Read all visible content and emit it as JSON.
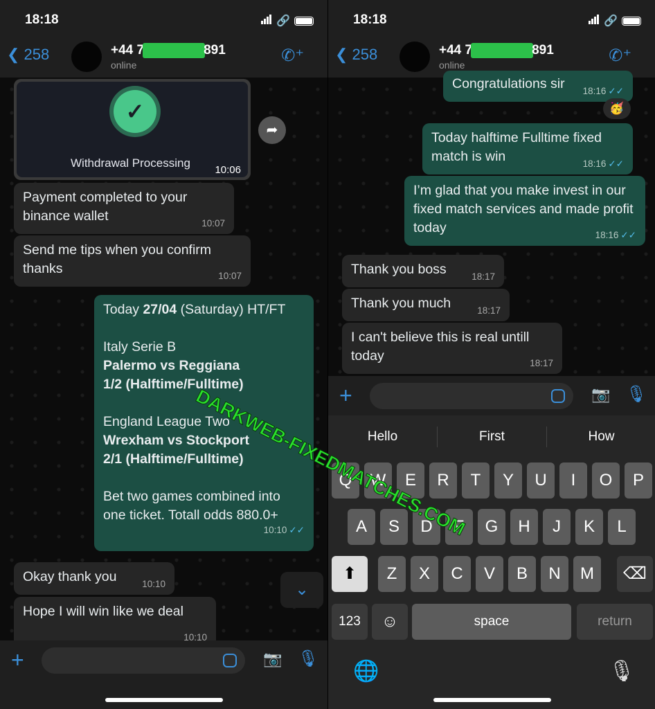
{
  "status": {
    "time": "18:18"
  },
  "header": {
    "back_count": "258",
    "name_prefix": "+44 7",
    "name_suffix": "891",
    "presence": "online"
  },
  "left": {
    "card": {
      "title": "Withdrawal Processing",
      "time": "10:06"
    },
    "messages": [
      {
        "text": "Payment completed to your binance wallet",
        "time": "10:07"
      },
      {
        "text": "Send me tips when you confirm thanks",
        "time": "10:07"
      },
      {
        "text": "Okay thank you",
        "time": "10:10"
      },
      {
        "text": "Hope I will win like we deal",
        "time": "10:10"
      }
    ],
    "tip": {
      "l1a": "Today ",
      "l1b": "27/04",
      "l1c": " (Saturday) HT/FT",
      "l2": "Italy Serie B",
      "l3": "Palermo vs Reggiana",
      "l4": "1/2 (Halftime/Fulltime)",
      "l5": "England League Two",
      "l6": "Wrexham vs Stockport",
      "l7": "2/1 (Halftime/Fulltime)",
      "l8": "Bet two games combined into one ticket. Totall odds 880.0+",
      "time": "10:10"
    }
  },
  "right": {
    "messages": [
      {
        "text": "Congratulations sir",
        "time": "18:16"
      },
      {
        "text": "Today halftime Fulltime fixed match is win",
        "time": "18:16"
      },
      {
        "text": "I’m glad that you make invest in our fixed match services and made profit today",
        "time": "18:16"
      },
      {
        "text": "Thank you boss",
        "time": "18:17"
      },
      {
        "text": "Thank you much",
        "time": "18:17"
      },
      {
        "text": "I can't believe this is real untill today",
        "time": "18:17"
      }
    ],
    "reaction": "🥳"
  },
  "keyboard": {
    "suggestions": [
      "Hello",
      "First",
      "How"
    ],
    "row1": [
      "Q",
      "W",
      "E",
      "R",
      "T",
      "Y",
      "U",
      "I",
      "O",
      "P"
    ],
    "row2": [
      "A",
      "S",
      "D",
      "F",
      "G",
      "H",
      "J",
      "K",
      "L"
    ],
    "row3": [
      "Z",
      "X",
      "C",
      "V",
      "B",
      "N",
      "M"
    ],
    "numbers": "123",
    "space": "space",
    "return": "return"
  },
  "watermark": "DARKWEB-FIXEDMATCHES.COM",
  "colors": {
    "accent": "#3b8fd9",
    "outgoing": "#1c4f44",
    "incoming": "#262626",
    "watermark": "#29e02c"
  }
}
